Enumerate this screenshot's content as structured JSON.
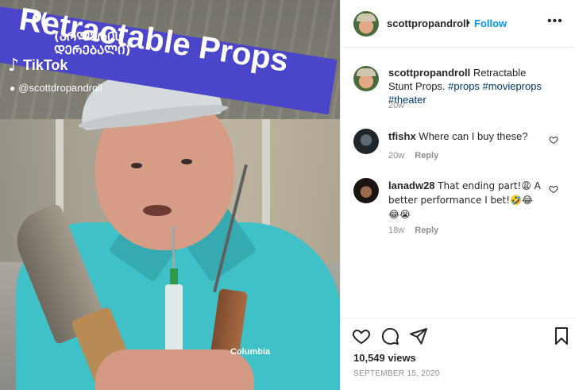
{
  "video": {
    "banner_text": "Retractable Props",
    "overlay_text": "(ᲐᲠᲚᲔᲠᲘᲡ ᲓᲔᲠᲔᲑᲐᲚᲘ)",
    "platform": "TikTok",
    "handle": "@scottdropandroll",
    "shirt_logo": "Columbia"
  },
  "header": {
    "username": "scottpropandroll",
    "separator": "•",
    "follow_label": "Follow",
    "more_icon": "more-horizontal-icon"
  },
  "caption": {
    "username": "scottpropandroll",
    "text": "Retractable Stunt Props.",
    "hashtags": [
      "#props",
      "#movieprops",
      "#theater"
    ],
    "age": "20w"
  },
  "comments": [
    {
      "username": "tfishx",
      "text": "Where can I buy these?",
      "age": "20w",
      "reply_label": "Reply"
    },
    {
      "username": "lanadw28",
      "text": "That ending part!😩 A better performance I bet!🤣😂",
      "extra": "😂😭",
      "age": "18w",
      "reply_label": "Reply"
    }
  ],
  "actions": {
    "views": "10,549 views",
    "date": "SEPTEMBER 15, 2020"
  },
  "colors": {
    "link": "#0095f6",
    "hashtag": "#00376b",
    "muted": "#8e8e8e",
    "banner": "#4b46c9",
    "shirt": "#3fc1c7"
  }
}
